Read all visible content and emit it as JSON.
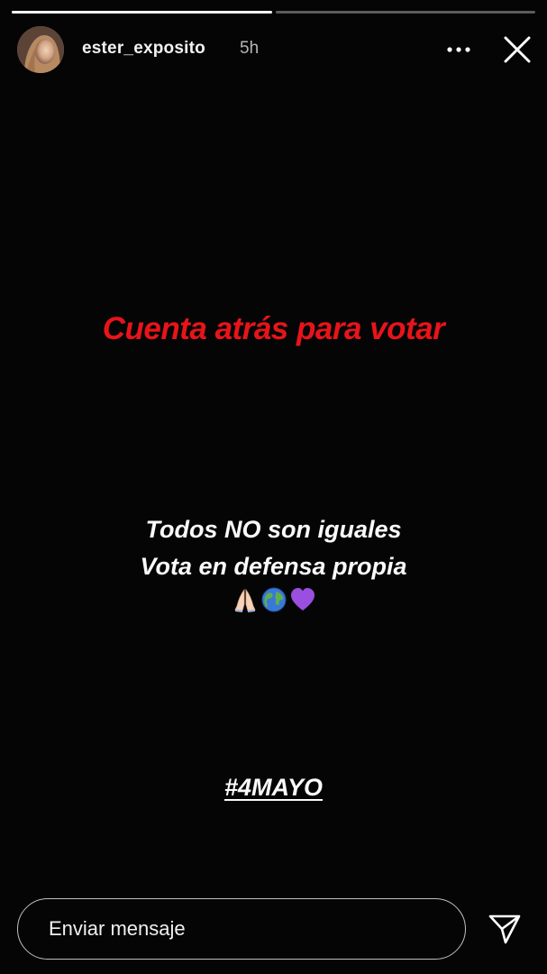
{
  "story": {
    "progress": [
      1.0,
      0.0
    ],
    "user": {
      "username": "ester_exposito",
      "time_ago": "5h"
    },
    "icons": {
      "more": "more-horizontal-icon",
      "close": "close-icon",
      "send": "send-icon"
    },
    "headline": "Cuenta atrás para votar",
    "line1": "Todos NO son iguales",
    "line2": "Vota en defensa propia",
    "emojis": [
      "folded-hands-emoji",
      "globe-emoji",
      "purple-heart-emoji"
    ],
    "hashtag": "#4MAYO",
    "colors": {
      "headline": "#e8141a",
      "text": "#fafafa",
      "background": "#050505"
    }
  },
  "composer": {
    "placeholder": "Enviar mensaje"
  }
}
